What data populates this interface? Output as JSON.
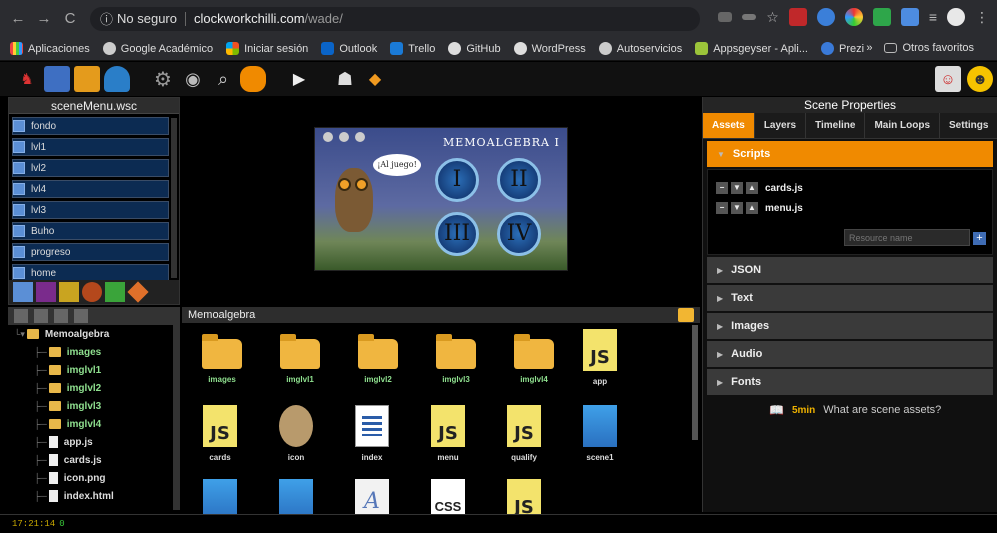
{
  "browser": {
    "security_label": "No seguro",
    "url_host": "clockworkchilli.com",
    "url_path": "/wade/",
    "bookmarks": [
      "Aplicaciones",
      "Google Académico",
      "Iniciar sesión",
      "Outlook",
      "Trello",
      "GitHub",
      "WordPress",
      "Autoservicios",
      "Appsgeyser - Apli...",
      "Prezi"
    ],
    "bookmarks_overflow": "»",
    "other_bookmarks": "Otros favoritos"
  },
  "scene_menu": {
    "title": "sceneMenu.wsc",
    "items": [
      "fondo",
      "lvl1",
      "lvl2",
      "lvl4",
      "lvl3",
      "Buho",
      "progreso",
      "home"
    ]
  },
  "game": {
    "title": "MEMOALGEBRA I",
    "bubble": "¡Al juego!",
    "numerals": [
      "I",
      "II",
      "III",
      "IV"
    ]
  },
  "properties": {
    "title": "Scene Properties",
    "tabs": [
      "Assets",
      "Layers",
      "Timeline",
      "Main Loops",
      "Settings"
    ],
    "scripts_section": "Scripts",
    "scripts": [
      "cards.js",
      "menu.js"
    ],
    "resource_placeholder": "Resource name",
    "sections": [
      "JSON",
      "Text",
      "Images",
      "Audio",
      "Fonts"
    ],
    "help_time": "5min",
    "help_text": "What are scene assets?"
  },
  "tree": {
    "root": "Memoalgebra",
    "folders": [
      "images",
      "imglvl1",
      "imglvl2",
      "imglvl3",
      "imglvl4"
    ],
    "files": [
      "app.js",
      "cards.js",
      "icon.png",
      "index.html"
    ]
  },
  "files": {
    "title": "Memoalgebra",
    "row1": [
      "images",
      "imglvl1",
      "imglvl2",
      "imglvl3",
      "imglvl4",
      "app"
    ],
    "row2": [
      "cards",
      "icon",
      "index",
      "menu",
      "qualify",
      "scene1"
    ],
    "doc_js": "JS",
    "doc_css": "CSS",
    "doc_a": "A"
  },
  "status": {
    "time": "17:21:14",
    "count": "0"
  }
}
